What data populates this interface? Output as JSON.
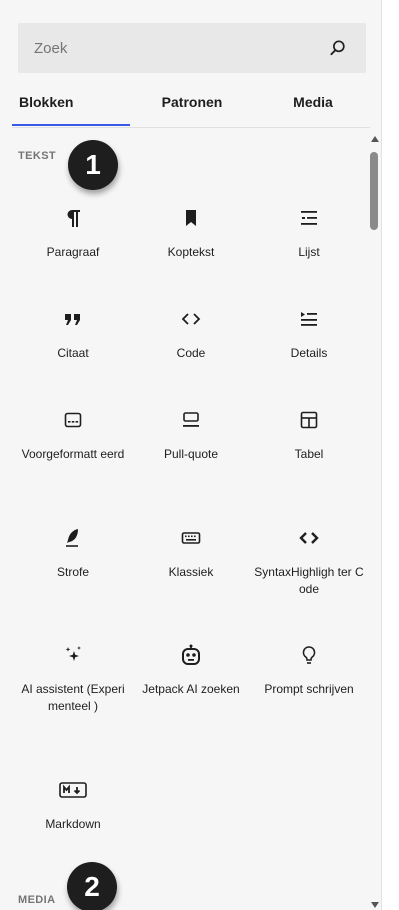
{
  "search": {
    "placeholder": "Zoek"
  },
  "tabs": [
    {
      "label": "Blokken"
    },
    {
      "label": "Patronen"
    },
    {
      "label": "Media"
    }
  ],
  "sections": {
    "tekst": "TEKST",
    "media": "MEDIA"
  },
  "badges": [
    "1",
    "2"
  ],
  "blocks": [
    {
      "label": "Paragraaf",
      "icon": "paragraph-icon"
    },
    {
      "label": "Koptekst",
      "icon": "bookmark-icon"
    },
    {
      "label": "Lijst",
      "icon": "list-icon"
    },
    {
      "label": "Citaat",
      "icon": "quote-icon"
    },
    {
      "label": "Code",
      "icon": "code-icon"
    },
    {
      "label": "Details",
      "icon": "details-icon"
    },
    {
      "label": "Voorgeformatt eerd",
      "icon": "preformatted-icon"
    },
    {
      "label": "Pull-quote",
      "icon": "pullquote-icon"
    },
    {
      "label": "Tabel",
      "icon": "table-icon"
    },
    {
      "label": "Strofe",
      "icon": "feather-icon"
    },
    {
      "label": "Klassiek",
      "icon": "keyboard-icon"
    },
    {
      "label": "SyntaxHighligh ter Code",
      "icon": "code-icon"
    },
    {
      "label": "AI assistent (Experimenteel )",
      "icon": "sparkles-icon"
    },
    {
      "label": "Jetpack AI zoeken",
      "icon": "robot-icon"
    },
    {
      "label": "Prompt schrijven",
      "icon": "lightbulb-icon"
    },
    {
      "label": "Markdown",
      "icon": "markdown-icon"
    }
  ],
  "colors": {
    "accent": "#3858e9",
    "text": "#1e1e1e",
    "muted": "#757575",
    "badge": "#1e1e1e"
  }
}
